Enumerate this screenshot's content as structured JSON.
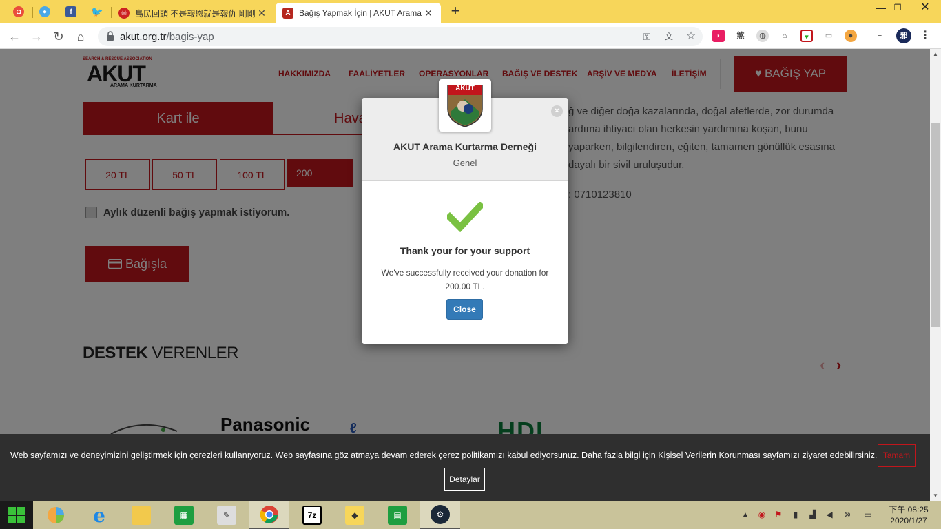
{
  "browser": {
    "tabs": [
      {
        "title": "",
        "icon": "page-icon"
      },
      {
        "title": "",
        "icon": "drop-icon"
      },
      {
        "title": "",
        "icon": "facebook-icon"
      },
      {
        "title": "",
        "icon": "twitter-icon"
      },
      {
        "title": "島民回頭 不是報恩就是報仇 剛剛",
        "icon": "pirate-icon"
      },
      {
        "title": "Bağış Yapmak İçin | AKUT Arama",
        "icon": "akut-icon",
        "active": true
      }
    ],
    "new_tab": "+",
    "url_host": "akut.org.tr",
    "url_path": "/bagis-yap",
    "ext_kanji": "煞"
  },
  "site": {
    "logo": {
      "top": "SEARCH & RESCUE ASSOCIATION",
      "main": "AKUT",
      "sub": "ARAMA KURTARMA"
    },
    "nav": [
      "HAKKIMIZDA",
      "FAALİYETLER",
      "OPERASYONLAR",
      "BAĞIŞ VE DESTEK",
      "ARŞİV VE MEDYA",
      "İLETİŞİM"
    ],
    "donate_top": "BAĞIŞ YAP",
    "tab_card": "Kart ile",
    "tab_havale": "Havale",
    "amounts": [
      "20 TL",
      "50 TL",
      "100 TL"
    ],
    "amount_input": "200",
    "monthly": "Aylık düzenli bağış yapmak istiyorum.",
    "donate_button": "Bağışla",
    "sponsors_bold": "DESTEK",
    "sponsors_rest": " VERENLER",
    "info_text": "ğ ve diğer doğa kazalarında, doğal afetlerde, zor durumda ardıma ihtiyacı olan herkesin yardımına koşan, bunu yaparken, bilgilendiren, eğiten, tamamen gönüllük esasına dayalı bir sivil uruluşudur.",
    "tax_number": ": 0710123810",
    "brands": {
      "panasonic": "Panasonic",
      "hdi": "HDI"
    }
  },
  "modal": {
    "org_name": "AKUT Arama Kurtarma Derneği",
    "category": "Genel",
    "logo_text": "AKUT",
    "thanks": "Thank your for your support",
    "received": "We've successfully received your donation for 200.00 TL.",
    "close": "Close",
    "close_x": "×"
  },
  "cookie": {
    "text": "Web sayfamızı ve deneyimizini geliştirmek için çerezleri kullanıyoruz. Web sayfasına göz atmaya devam ederek çerez politikamızı kabul ediyorsunuz. Daha fazla bilgi için Kişisel Verilerin Korunması sayfamızı ziyaret edebilirsiniz.",
    "ok": "Tamam",
    "details": "Detaylar"
  },
  "taskbar": {
    "time": "下午 08:25",
    "date": "2020/1/27",
    "sevenzip": "7z"
  },
  "colors": {
    "brand_red": "#c2161c",
    "tab_strip": "#f7d65a",
    "taskbar": "#c9c39a",
    "close_blue": "#337ab7",
    "check_green": "#7ac142"
  }
}
